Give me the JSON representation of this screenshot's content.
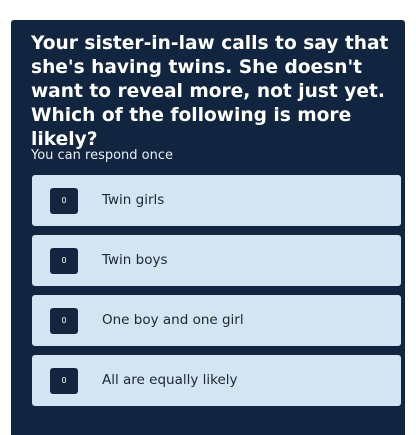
{
  "poll": {
    "question": "Your sister-in-law calls to say that she's having twins. She doesn't want to reveal more, not just yet. Which of the following is more likely?",
    "hint": "You can respond once",
    "options": [
      {
        "label": "Twin girls",
        "count": "0"
      },
      {
        "label": "Twin boys",
        "count": "0"
      },
      {
        "label": "One boy and one girl",
        "count": "0"
      },
      {
        "label": "All are equally likely",
        "count": "0"
      }
    ]
  },
  "colors": {
    "card_background": "#112540",
    "option_background": "#d3e4f3",
    "badge_background": "#14263f"
  }
}
